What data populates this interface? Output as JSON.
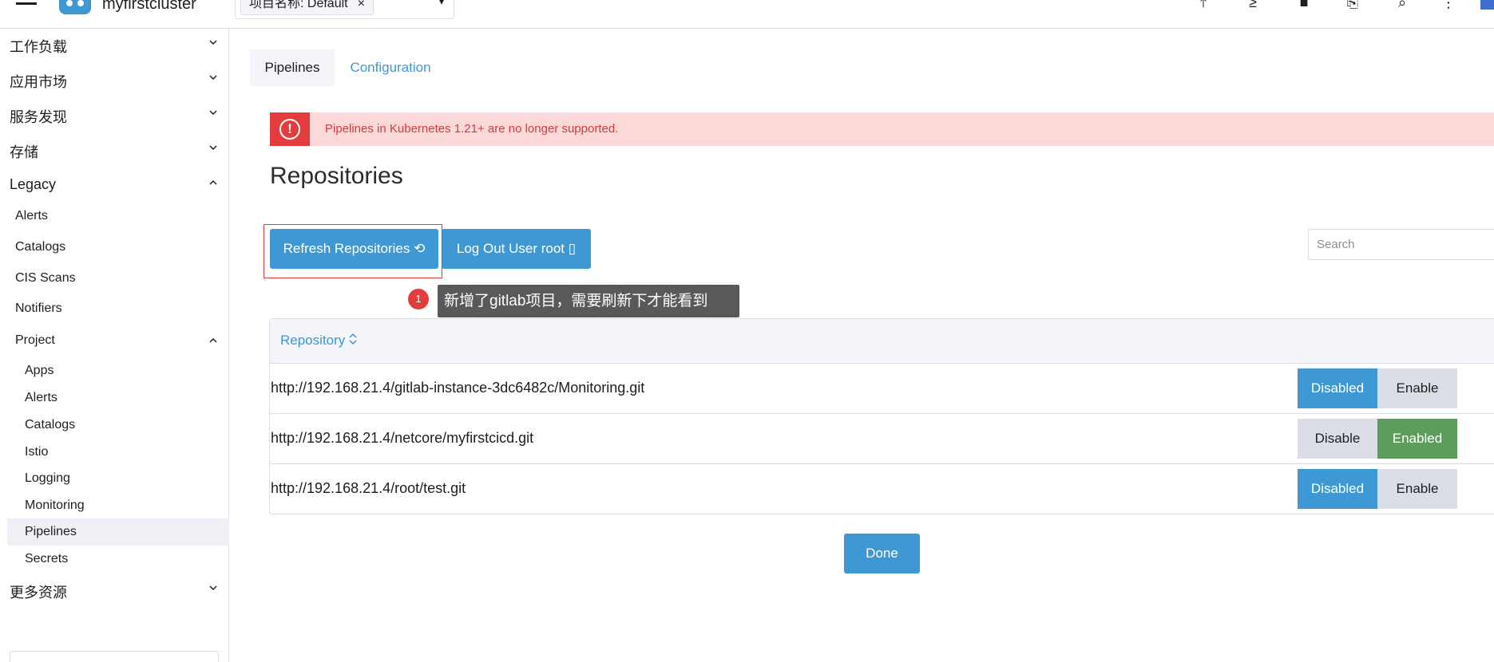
{
  "header": {
    "cluster_name": "myfirstcluster",
    "project_chip": "项目名称: Default",
    "project_chip_close": "×"
  },
  "sidebar": {
    "groups": [
      {
        "label": "工作负载"
      },
      {
        "label": "应用市场"
      },
      {
        "label": "服务发现"
      },
      {
        "label": "存储"
      },
      {
        "label": "Legacy"
      },
      {
        "label": "更多资源"
      }
    ],
    "legacy_items": [
      "Alerts",
      "Catalogs",
      "CIS Scans",
      "Notifiers"
    ],
    "project_label": "Project",
    "project_items": [
      "Apps",
      "Alerts",
      "Catalogs",
      "Istio",
      "Logging",
      "Monitoring",
      "Pipelines",
      "Secrets"
    ],
    "active_item": "Pipelines"
  },
  "tabs": {
    "pipelines": "Pipelines",
    "configuration": "Configuration"
  },
  "banner": {
    "text": "Pipelines in Kubernetes 1.21+ are no longer supported."
  },
  "main": {
    "title": "Repositories",
    "refresh_label": "Refresh Repositories",
    "logout_label": "Log Out User root",
    "search_placeholder": "Search",
    "annotation_number": "1",
    "annotation_text": "新增了gitlab项目，需要刷新下才能看到",
    "done_label": "Done"
  },
  "table": {
    "header": "Repository",
    "rows": [
      {
        "url": "http://192.168.21.4/gitlab-instance-3dc6482c/Monitoring.git",
        "left": "Disabled",
        "right": "Enable",
        "state": "disabled"
      },
      {
        "url": "http://192.168.21.4/netcore/myfirstcicd.git",
        "left": "Disable",
        "right": "Enabled",
        "state": "enabled"
      },
      {
        "url": "http://192.168.21.4/root/test.git",
        "left": "Disabled",
        "right": "Enable",
        "state": "disabled"
      }
    ]
  },
  "colors": {
    "accent": "#3d98d3",
    "enabled": "#5a9e5a",
    "error": "#e43c3c",
    "banner_bg": "#fdd8d8"
  }
}
